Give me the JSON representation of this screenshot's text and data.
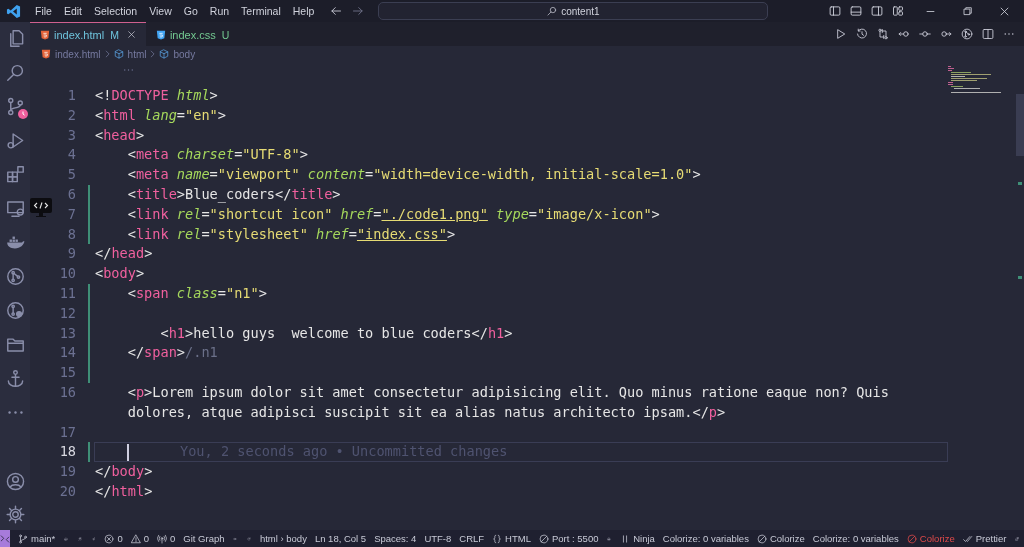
{
  "window": {
    "menu": [
      "File",
      "Edit",
      "Selection",
      "View",
      "Go",
      "Run",
      "Terminal",
      "Help"
    ],
    "command_center": "content1"
  },
  "tabs": [
    {
      "label": "index.html",
      "status": "M",
      "selected": true,
      "color": "#6ec3dc",
      "kind": "html"
    },
    {
      "label": "index.css",
      "status": "U",
      "selected": false,
      "color": "#73c991",
      "kind": "css"
    }
  ],
  "breadcrumb": [
    {
      "text": "index.html",
      "kind": "file"
    },
    {
      "text": "html",
      "kind": "symbol"
    },
    {
      "text": "body",
      "kind": "symbol"
    }
  ],
  "editor": {
    "rows": [
      {
        "number": "1",
        "changed": false,
        "current": false,
        "tokens": [
          {
            "kind": "p",
            "text": "<!"
          },
          {
            "kind": "tag",
            "text": "DOCTYPE"
          },
          {
            "kind": "attr",
            "text": " html"
          },
          {
            "kind": "p",
            "text": ">"
          }
        ]
      },
      {
        "number": "2",
        "changed": false,
        "current": false,
        "tokens": [
          {
            "kind": "p",
            "text": "<"
          },
          {
            "kind": "tag",
            "text": "html"
          },
          {
            "kind": "attr",
            "text": " lang"
          },
          {
            "kind": "p",
            "text": "="
          },
          {
            "kind": "str",
            "text": "\"en\""
          },
          {
            "kind": "p",
            "text": ">"
          }
        ]
      },
      {
        "number": "3",
        "changed": false,
        "current": false,
        "tokens": [
          {
            "kind": "p",
            "text": "<"
          },
          {
            "kind": "tag",
            "text": "head"
          },
          {
            "kind": "p",
            "text": ">"
          }
        ]
      },
      {
        "number": "4",
        "changed": false,
        "current": false,
        "tokens": [
          {
            "kind": "p",
            "text": "    <"
          },
          {
            "kind": "tag",
            "text": "meta"
          },
          {
            "kind": "attr",
            "text": " charset"
          },
          {
            "kind": "p",
            "text": "="
          },
          {
            "kind": "str",
            "text": "\"UTF-8\""
          },
          {
            "kind": "p",
            "text": ">"
          }
        ]
      },
      {
        "number": "5",
        "changed": false,
        "current": false,
        "tokens": [
          {
            "kind": "p",
            "text": "    <"
          },
          {
            "kind": "tag",
            "text": "meta"
          },
          {
            "kind": "attr",
            "text": " name"
          },
          {
            "kind": "p",
            "text": "="
          },
          {
            "kind": "str",
            "text": "\"viewport\""
          },
          {
            "kind": "attr",
            "text": " content"
          },
          {
            "kind": "p",
            "text": "="
          },
          {
            "kind": "str",
            "text": "\"width=device-width, initial-scale=1.0\""
          },
          {
            "kind": "p",
            "text": ">"
          }
        ]
      },
      {
        "number": "6",
        "changed": true,
        "current": false,
        "tokens": [
          {
            "kind": "p",
            "text": "    <"
          },
          {
            "kind": "tag",
            "text": "title"
          },
          {
            "kind": "p",
            "text": ">Blue_coders</"
          },
          {
            "kind": "tag",
            "text": "title"
          },
          {
            "kind": "p",
            "text": ">"
          }
        ]
      },
      {
        "number": "7",
        "changed": true,
        "current": false,
        "tokens": [
          {
            "kind": "p",
            "text": "    <"
          },
          {
            "kind": "tag",
            "text": "link"
          },
          {
            "kind": "attr",
            "text": " rel"
          },
          {
            "kind": "p",
            "text": "="
          },
          {
            "kind": "str",
            "text": "\"shortcut icon\""
          },
          {
            "kind": "attr",
            "text": " href"
          },
          {
            "kind": "p",
            "text": "="
          },
          {
            "kind": "link",
            "text": "\"./code1.png\""
          },
          {
            "kind": "attr",
            "text": " type"
          },
          {
            "kind": "p",
            "text": "="
          },
          {
            "kind": "str",
            "text": "\"image/x-icon\""
          },
          {
            "kind": "p",
            "text": ">"
          }
        ]
      },
      {
        "number": "8",
        "changed": true,
        "current": false,
        "tokens": [
          {
            "kind": "p",
            "text": "    <"
          },
          {
            "kind": "tag",
            "text": "link"
          },
          {
            "kind": "attr",
            "text": " rel"
          },
          {
            "kind": "p",
            "text": "="
          },
          {
            "kind": "str",
            "text": "\"stylesheet\""
          },
          {
            "kind": "attr",
            "text": " href"
          },
          {
            "kind": "p",
            "text": "="
          },
          {
            "kind": "link",
            "text": "\"index.css\""
          },
          {
            "kind": "p",
            "text": ">"
          }
        ]
      },
      {
        "number": "9",
        "changed": false,
        "current": false,
        "tokens": [
          {
            "kind": "p",
            "text": "</"
          },
          {
            "kind": "tag",
            "text": "head"
          },
          {
            "kind": "p",
            "text": ">"
          }
        ]
      },
      {
        "number": "10",
        "changed": false,
        "current": false,
        "tokens": [
          {
            "kind": "p",
            "text": "<"
          },
          {
            "kind": "tag",
            "text": "body"
          },
          {
            "kind": "p",
            "text": ">"
          }
        ]
      },
      {
        "number": "11",
        "changed": true,
        "current": false,
        "tokens": [
          {
            "kind": "p",
            "text": "    <"
          },
          {
            "kind": "tag",
            "text": "span"
          },
          {
            "kind": "attr",
            "text": " class"
          },
          {
            "kind": "p",
            "text": "="
          },
          {
            "kind": "str",
            "text": "\"n1\""
          },
          {
            "kind": "p",
            "text": ">"
          }
        ]
      },
      {
        "number": "12",
        "changed": true,
        "current": false
      },
      {
        "number": "13",
        "changed": true,
        "current": false,
        "tokens": [
          {
            "kind": "p",
            "text": "        <"
          },
          {
            "kind": "tag",
            "text": "h1"
          },
          {
            "kind": "p",
            "text": ">hello guys  welcome to blue coders</"
          },
          {
            "kind": "tag",
            "text": "h1"
          },
          {
            "kind": "p",
            "text": ">"
          }
        ]
      },
      {
        "number": "14",
        "changed": true,
        "current": false,
        "tokens": [
          {
            "kind": "p",
            "text": "    </"
          },
          {
            "kind": "tag",
            "text": "span"
          },
          {
            "kind": "p",
            "text": ">"
          },
          {
            "kind": "dim",
            "text": "/.n1"
          }
        ]
      },
      {
        "number": "15",
        "changed": true,
        "current": false
      },
      {
        "number": "16",
        "changed": false,
        "current": false,
        "tokens": [
          {
            "kind": "p",
            "text": "    <"
          },
          {
            "kind": "tag",
            "text": "p"
          },
          {
            "kind": "p",
            "text": ">Lorem ipsum dolor sit amet consectetur adipisicing elit. Quo minus ratione eaque non? Quis"
          }
        ]
      },
      {
        "changed": false,
        "current": false,
        "tokens": [
          {
            "kind": "p",
            "text": "    dolores, atque adipisci suscipit sit ea alias natus architecto ipsam.</"
          },
          {
            "kind": "tag",
            "text": "p"
          },
          {
            "kind": "p",
            "text": ">"
          }
        ]
      },
      {
        "number": "17",
        "changed": false,
        "current": false
      },
      {
        "number": "18",
        "changed": true,
        "current": true,
        "blame": "You, 2 seconds ago • Uncommitted changes"
      },
      {
        "number": "19",
        "changed": false,
        "current": false,
        "tokens": [
          {
            "kind": "p",
            "text": "</"
          },
          {
            "kind": "tag",
            "text": "body"
          },
          {
            "kind": "p",
            "text": ">"
          }
        ]
      },
      {
        "number": "20",
        "changed": false,
        "current": false,
        "tokens": [
          {
            "kind": "p",
            "text": "</"
          },
          {
            "kind": "tag",
            "text": "html"
          },
          {
            "kind": "p",
            "text": ">"
          }
        ]
      }
    ]
  },
  "status_bar": {
    "items": [
      {
        "text": "main*",
        "alert": false
      },
      {
        "text": "0",
        "alert": false
      },
      {
        "text": "0",
        "alert": false
      },
      {
        "text": "0",
        "alert": false
      },
      {
        "text": "Git Graph",
        "alert": false
      },
      {
        "text": "html › body",
        "alert": false
      },
      {
        "text": "Ln 18, Col 5",
        "alert": false
      },
      {
        "text": "Spaces: 4",
        "alert": false
      },
      {
        "text": "UTF-8",
        "alert": false
      },
      {
        "text": "CRLF",
        "alert": false
      },
      {
        "text": "HTML",
        "alert": false
      },
      {
        "text": "Port : 5500",
        "alert": false
      },
      {
        "text": "Ninja",
        "alert": false
      },
      {
        "text": "Colorize: 0 variables",
        "alert": false
      },
      {
        "text": "Colorize",
        "alert": false
      },
      {
        "text": "Colorize: 0 variables",
        "alert": false
      },
      {
        "text": "Colorize",
        "alert": true
      },
      {
        "text": "Prettier",
        "alert": false
      }
    ]
  }
}
